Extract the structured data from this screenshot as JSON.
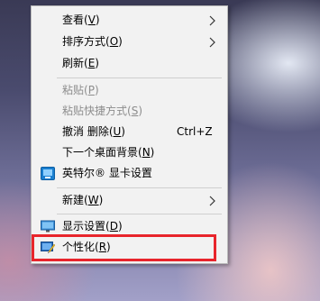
{
  "menu": {
    "items": [
      {
        "pre": "查看(",
        "key": "V",
        "post": ")",
        "shortcut": "",
        "submenu": true,
        "enabled": true,
        "icon": ""
      },
      {
        "pre": "排序方式(",
        "key": "O",
        "post": ")",
        "shortcut": "",
        "submenu": true,
        "enabled": true,
        "icon": ""
      },
      {
        "pre": "刷新(",
        "key": "E",
        "post": ")",
        "shortcut": "",
        "submenu": false,
        "enabled": true,
        "icon": ""
      },
      {
        "pre": "粘贴(",
        "key": "P",
        "post": ")",
        "shortcut": "",
        "submenu": false,
        "enabled": false,
        "icon": ""
      },
      {
        "pre": "粘贴快捷方式(",
        "key": "S",
        "post": ")",
        "shortcut": "",
        "submenu": false,
        "enabled": false,
        "icon": ""
      },
      {
        "pre": "撤消 删除(",
        "key": "U",
        "post": ")",
        "shortcut": "Ctrl+Z",
        "submenu": false,
        "enabled": true,
        "icon": ""
      },
      {
        "pre": "下一个桌面背景(",
        "key": "N",
        "post": ")",
        "shortcut": "",
        "submenu": false,
        "enabled": true,
        "icon": ""
      },
      {
        "pre": "英特尔® 显卡设置",
        "key": "",
        "post": "",
        "shortcut": "",
        "submenu": false,
        "enabled": true,
        "icon": "intel-graphics-icon"
      },
      {
        "pre": "新建(",
        "key": "W",
        "post": ")",
        "shortcut": "",
        "submenu": true,
        "enabled": true,
        "icon": ""
      },
      {
        "pre": "显示设置(",
        "key": "D",
        "post": ")",
        "shortcut": "",
        "submenu": false,
        "enabled": true,
        "icon": "display-settings-icon"
      },
      {
        "pre": "个性化(",
        "key": "R",
        "post": ")",
        "shortcut": "",
        "submenu": false,
        "enabled": true,
        "icon": "personalize-icon"
      }
    ]
  },
  "colors": {
    "menu_background": "#f2f2f2",
    "disabled_text": "#8d8d8d",
    "highlight_border": "#e8252c"
  }
}
